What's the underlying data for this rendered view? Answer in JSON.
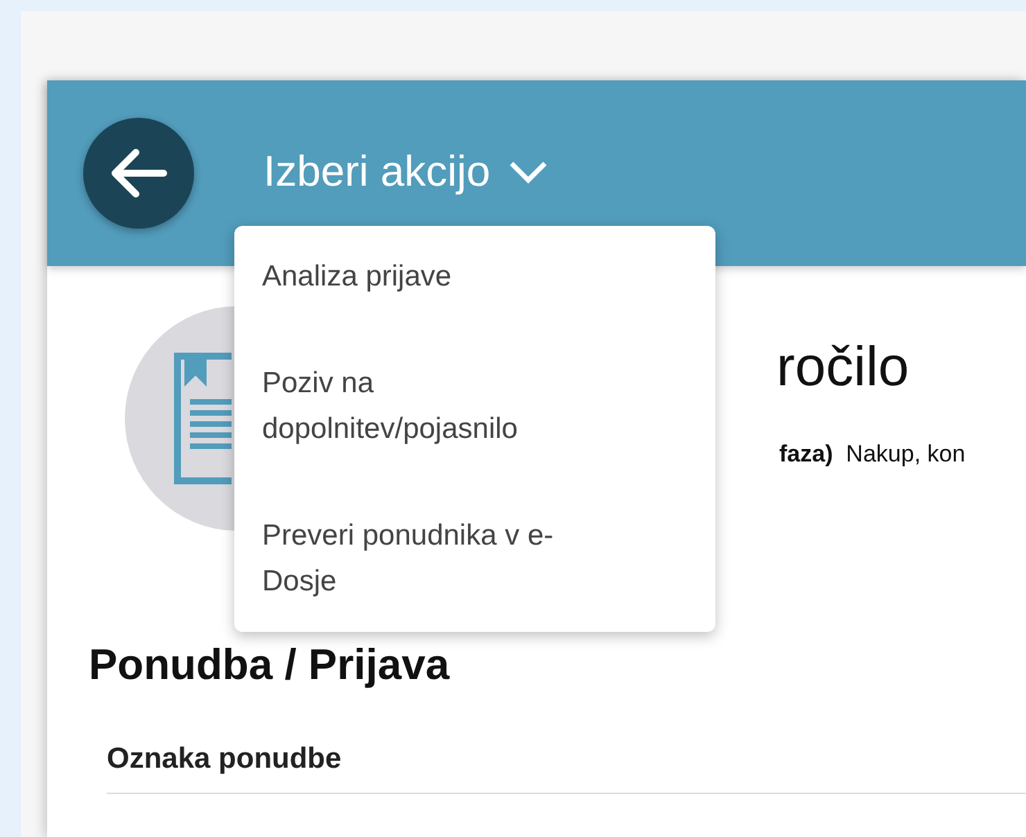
{
  "header": {
    "action_label": "Izberi akcijo"
  },
  "action_menu": {
    "expanded": true,
    "items": [
      {
        "label": "Analiza prijave"
      },
      {
        "label": "Poziv na dopolnitev/pojasnilo"
      },
      {
        "label": "Preveri ponudnika v e-Dosje"
      }
    ]
  },
  "summary": {
    "title": "ročilo",
    "subtitle": "**faza)**  Nakup, kon"
  },
  "section": {
    "heading": "Ponudba / Prijava",
    "field_label": "Oznaka ponudbe"
  }
}
